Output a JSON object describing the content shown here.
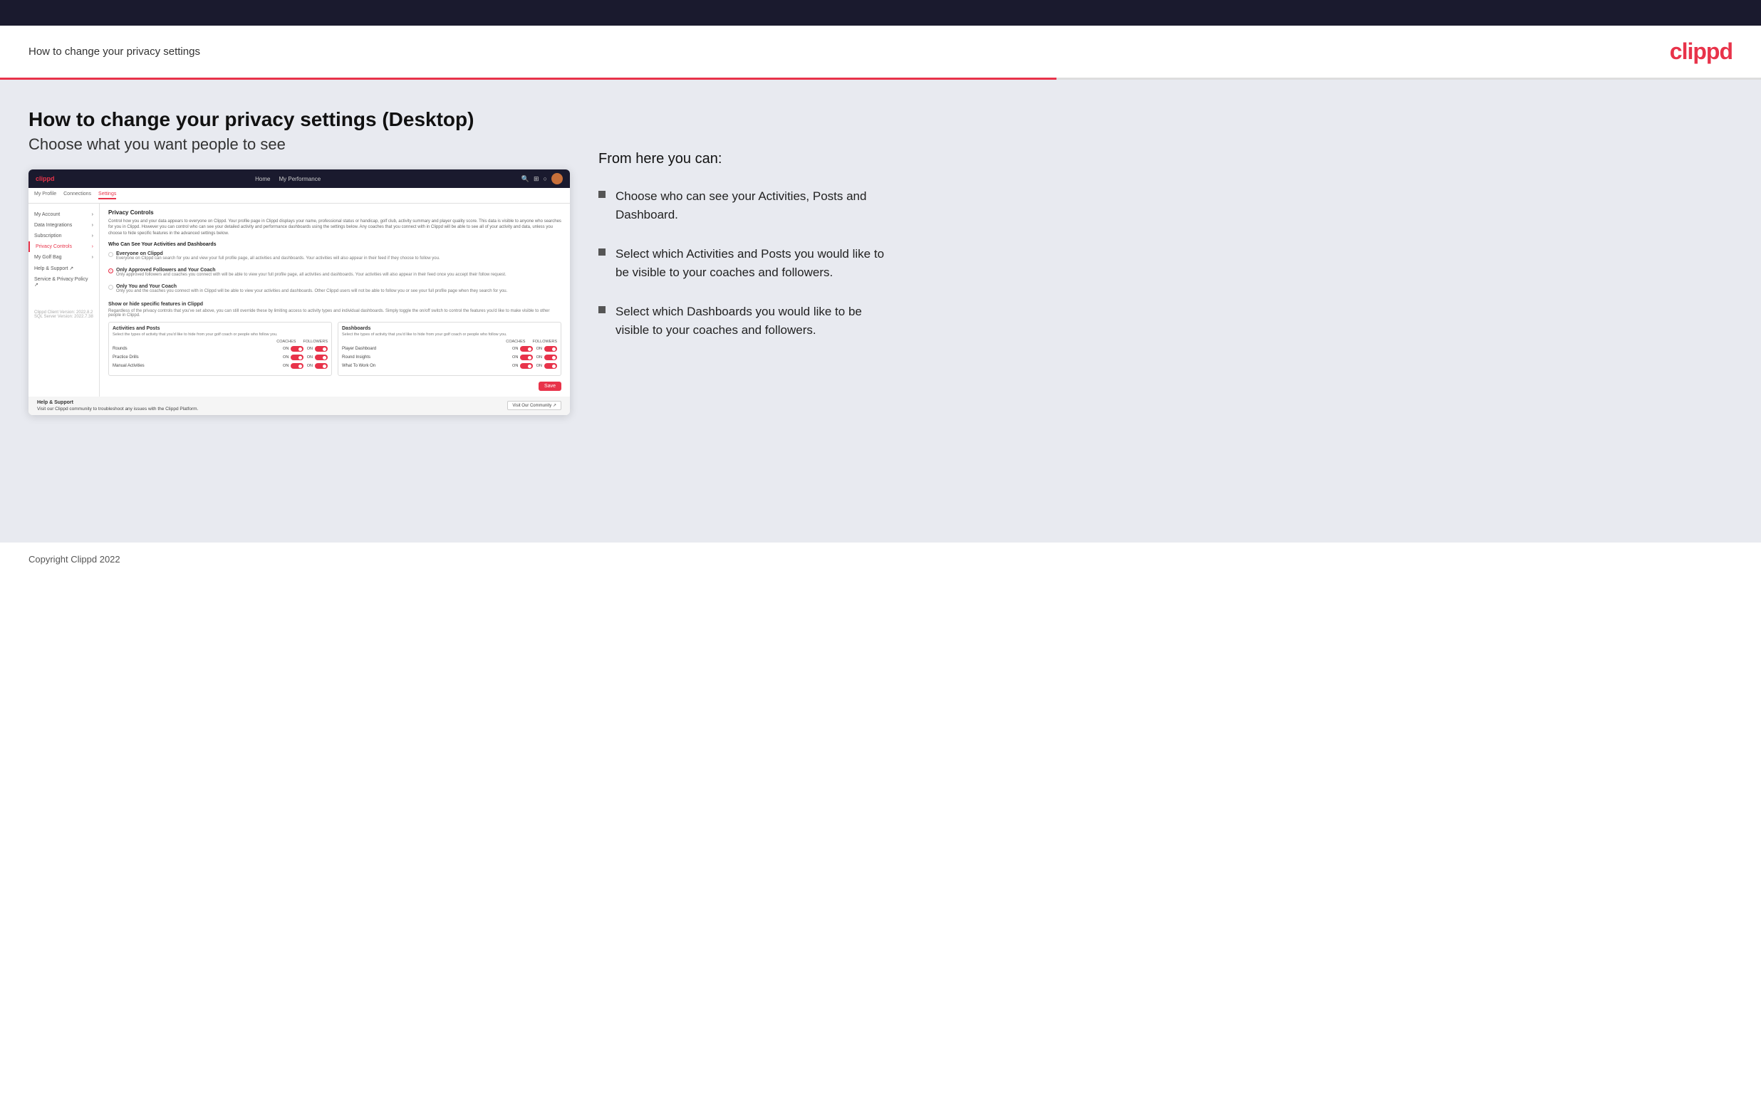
{
  "topbar": {},
  "header": {
    "title": "How to change your privacy settings",
    "logo": "clippd"
  },
  "main": {
    "heading": "How to change your privacy settings (Desktop)",
    "subheading": "Choose what you want people to see"
  },
  "mini_app": {
    "logo": "clippd",
    "nav": {
      "links": [
        "Home",
        "My Performance"
      ]
    },
    "sub_nav": {
      "tabs": [
        "My Profile",
        "Connections",
        "Settings"
      ]
    },
    "sidebar": {
      "items": [
        {
          "label": "My Account",
          "active": false,
          "arrow": true
        },
        {
          "label": "Data Integrations",
          "active": false,
          "arrow": true
        },
        {
          "label": "Subscription",
          "active": false,
          "arrow": true
        },
        {
          "label": "Privacy Controls",
          "active": true,
          "arrow": true
        },
        {
          "label": "My Golf Bag",
          "active": false,
          "arrow": true
        },
        {
          "label": "Help & Support",
          "active": false
        },
        {
          "label": "Service & Privacy Policy",
          "active": false
        }
      ],
      "version": "Clippd Client Version: 2022.8.2\nSQL Server Version: 2022.7.38"
    },
    "main": {
      "section_title": "Privacy Controls",
      "section_desc": "Control how you and your data appears to everyone on Clippd. Your profile page in Clippd displays your name, professional status or handicap, golf club, activity summary and player quality score. This data is visible to anyone who searches for you in Clippd. However you can control who can see your detailed activity and performance dashboards using the settings below. Any coaches that you connect with in Clippd will be able to see all of your activity and data, unless you choose to hide specific features in the advanced settings below.",
      "who_title": "Who Can See Your Activities and Dashboards",
      "radio_options": [
        {
          "label": "Everyone on Clippd",
          "desc": "Everyone on Clippd can search for you and view your full profile page, all activities and dashboards. Your activities will also appear in their feed if they choose to follow you.",
          "selected": false
        },
        {
          "label": "Only Approved Followers and Your Coach",
          "desc": "Only approved followers and coaches you connect with will be able to view your full profile page, all activities and dashboards. Your activities will also appear in their feed once you accept their follow request.",
          "selected": true
        },
        {
          "label": "Only You and Your Coach",
          "desc": "Only you and the coaches you connect with in Clippd will be able to view your activities and dashboards. Other Clippd users will not be able to follow you or see your full profile page when they search for you.",
          "selected": false
        }
      ],
      "show_hide_title": "Show or hide specific features in Clippd",
      "show_hide_desc": "Regardless of the privacy controls that you've set above, you can still override these by limiting access to activity types and individual dashboards. Simply toggle the on/off switch to control the features you'd like to make visible to other people in Clippd.",
      "activities_box": {
        "title": "Activities and Posts",
        "desc": "Select the types of activity that you'd like to hide from your golf coach or people who follow you.",
        "cols": [
          "COACHES",
          "FOLLOWERS"
        ],
        "rows": [
          {
            "label": "Rounds",
            "coaches": "ON",
            "followers": "ON"
          },
          {
            "label": "Practice Drills",
            "coaches": "ON",
            "followers": "ON"
          },
          {
            "label": "Manual Activities",
            "coaches": "ON",
            "followers": "ON"
          }
        ]
      },
      "dashboards_box": {
        "title": "Dashboards",
        "desc": "Select the types of activity that you'd like to hide from your golf coach or people who follow you.",
        "cols": [
          "COACHES",
          "FOLLOWERS"
        ],
        "rows": [
          {
            "label": "Player Dashboard",
            "coaches": "ON",
            "followers": "ON"
          },
          {
            "label": "Round Insights",
            "coaches": "ON",
            "followers": "ON"
          },
          {
            "label": "What To Work On",
            "coaches": "ON",
            "followers": "ON"
          }
        ]
      },
      "save_button": "Save"
    },
    "help": {
      "title": "Help & Support",
      "desc": "Visit our Clippd community to troubleshoot any issues with the Clippd Platform.",
      "visit_button": "Visit Our Community"
    }
  },
  "right_panel": {
    "heading": "From here you can:",
    "bullets": [
      "Choose who can see your Activities, Posts and Dashboard.",
      "Select which Activities and Posts you would like to be visible to your coaches and followers.",
      "Select which Dashboards you would like to be visible to your coaches and followers."
    ]
  },
  "footer": {
    "text": "Copyright Clippd 2022"
  }
}
